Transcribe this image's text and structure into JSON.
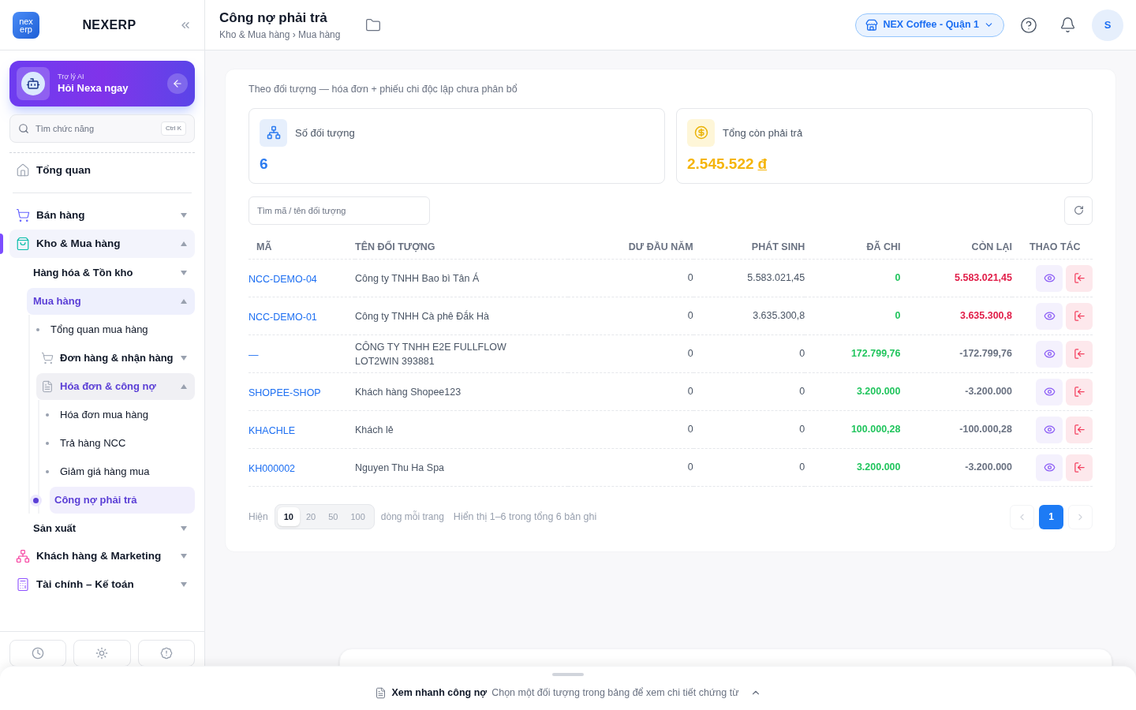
{
  "brand": {
    "logo_lines": [
      "nex",
      "erp"
    ],
    "name": "NEXERP"
  },
  "assistant": {
    "caption": "Trợ lý AI",
    "title": "Hỏi Nexa ngay"
  },
  "nav_search": {
    "placeholder": "Tìm chức năng",
    "shortcut": "Ctrl K"
  },
  "nav": [
    {
      "label": "Tổng quan",
      "kind": "home",
      "selected": false
    },
    {
      "label": "Bán hàng",
      "kind": "cart",
      "expanded": false
    },
    {
      "label": "Kho & Mua hàng",
      "kind": "bag",
      "expanded": true,
      "children": [
        {
          "label": "Hàng hóa & Tồn kho",
          "expanded": false
        },
        {
          "label": "Mua hàng",
          "expanded": true,
          "children": [
            {
              "label": "Tổng quan mua hàng",
              "kind": "bullet",
              "selected": false
            },
            {
              "label": "Đơn hàng & nhận hàng",
              "kind": "cart",
              "expanded": false
            },
            {
              "label": "Hóa đơn & công nợ",
              "kind": "document",
              "expanded": true,
              "children": [
                {
                  "label": "Hóa đơn mua hàng",
                  "kind": "bullet",
                  "selected": false
                },
                {
                  "label": "Trả hàng NCC",
                  "kind": "bullet",
                  "selected": false
                },
                {
                  "label": "Giảm giá hàng mua",
                  "kind": "bullet",
                  "selected": false
                },
                {
                  "label": "Công nợ phải trả",
                  "kind": "bullet",
                  "selected": true
                }
              ]
            }
          ]
        },
        {
          "label": "Sản xuất",
          "expanded": false
        }
      ]
    },
    {
      "label": "Khách hàng & Marketing",
      "kind": "people",
      "expanded": false
    },
    {
      "label": "Tài chính – Kế toán",
      "kind": "calculator",
      "expanded": false
    }
  ],
  "header": {
    "title": "Công nợ phải trả",
    "breadcrumb": "Kho & Mua hàng › Mua hàng",
    "store": "NEX Coffee - Quận 1",
    "avatar": "S"
  },
  "panel": {
    "note": "Theo đối tượng — hóa đơn + phiếu chi độc lập chưa phân bổ",
    "stats": [
      {
        "label": "Số đối tượng",
        "value": "6",
        "kind": "count"
      },
      {
        "label": "Tổng còn phải trả",
        "value": "2.545.522",
        "currency": "đ",
        "kind": "money"
      }
    ],
    "search": {
      "placeholder": "Tìm mã / tên đối tượng"
    }
  },
  "table": {
    "columns": [
      "MÃ",
      "TÊN ĐỐI TƯỢNG",
      "DƯ ĐẦU NĂM",
      "PHÁT SINH",
      "ĐÃ CHI",
      "CÒN LẠI",
      "THAO TÁC"
    ],
    "rows": [
      {
        "code": "NCC-DEMO-04",
        "name": "Công ty TNHH Bao bì Tân Á",
        "opening": "0",
        "incurred": "5.583.021,45",
        "paid": "0",
        "remaining": "5.583.021,45",
        "owing": true
      },
      {
        "code": "NCC-DEMO-01",
        "name": "Công ty TNHH Cà phê Đắk Hà",
        "opening": "0",
        "incurred": "3.635.300,8",
        "paid": "0",
        "remaining": "3.635.300,8",
        "owing": true
      },
      {
        "code": "—",
        "name": "CÔNG TY TNHH E2E FULLFLOW LOT2WIN 393881",
        "opening": "0",
        "incurred": "0",
        "paid": "172.799,76",
        "remaining": "-172.799,76",
        "owing": false
      },
      {
        "code": "SHOPEE-SHOP",
        "name": "Khách hàng Shopee123",
        "opening": "0",
        "incurred": "0",
        "paid": "3.200.000",
        "remaining": "-3.200.000",
        "owing": false
      },
      {
        "code": "KHACHLE",
        "name": "Khách lẻ",
        "opening": "0",
        "incurred": "0",
        "paid": "100.000,28",
        "remaining": "-100.000,28",
        "owing": false
      },
      {
        "code": "KH000002",
        "name": "Nguyen Thu Ha Spa",
        "opening": "0",
        "incurred": "0",
        "paid": "3.200.000",
        "remaining": "-3.200.000",
        "owing": false
      }
    ]
  },
  "pagination": {
    "prefix": "Hiện",
    "sizes": [
      {
        "label": "10",
        "selected": true
      },
      {
        "label": "20",
        "selected": false
      },
      {
        "label": "50",
        "selected": false
      },
      {
        "label": "100",
        "selected": false
      }
    ],
    "suffix": "dòng mỗi trang",
    "summary": "Hiển thị 1–6 trong tổng 6 bản ghi",
    "pages": [
      {
        "label": "1",
        "selected": true
      }
    ]
  },
  "drawer": {
    "title": "Xem nhanh công nợ",
    "hint": "Chọn một đối tượng trong bảng để xem chi tiết chứng từ"
  }
}
